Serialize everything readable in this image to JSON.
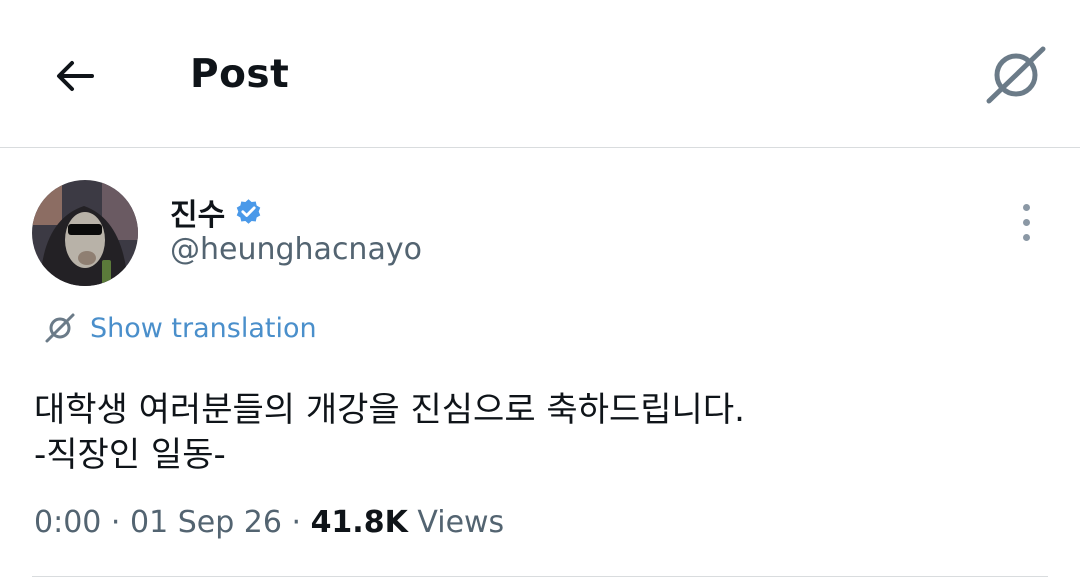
{
  "header": {
    "title": "Post",
    "back_icon": "arrow-left-icon",
    "translate_icon": "translate-icon"
  },
  "tweet": {
    "author": {
      "display_name": "진수",
      "handle": "@heunghacnayo",
      "verified": true,
      "verified_color": "#4a99e9",
      "avatar": "avatar-image"
    },
    "more_icon": "more-vertical-icon",
    "show_translation": "Show translation",
    "text_lines": [
      "대학생 여러분들의 개강을 진심으로 축하드립니다.",
      "-직장인 일동-"
    ],
    "meta": {
      "time": "0:00",
      "sep1": " · ",
      "date": "01 Sep 26",
      "sep2": " · ",
      "view_count": "41.8K",
      "views_label": " Views"
    }
  },
  "colors": {
    "accent": "#4a8fcb",
    "secondary_text": "#536471",
    "divider": "#d9dcde"
  }
}
